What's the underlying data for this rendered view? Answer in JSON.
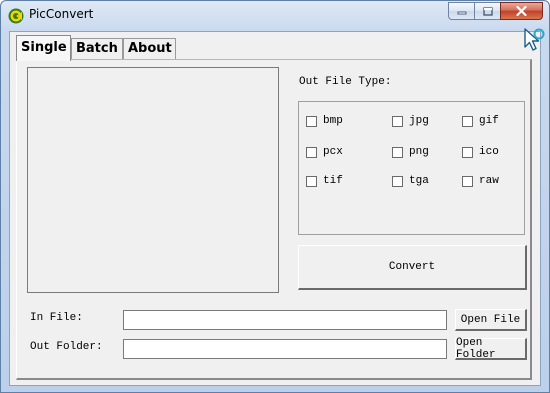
{
  "window": {
    "title": "PicConvert",
    "icon": "app-logo-icon",
    "controls": {
      "minimize": "minimize-icon",
      "maximize": "maximize-icon",
      "close": "close-icon"
    }
  },
  "tabs": [
    {
      "label": "Single",
      "active": true
    },
    {
      "label": "Batch",
      "active": false
    },
    {
      "label": "About",
      "active": false
    }
  ],
  "single": {
    "out_file_type_label": "Out File Type:",
    "formats": [
      {
        "label": "bmp",
        "checked": false
      },
      {
        "label": "jpg",
        "checked": false
      },
      {
        "label": "gif",
        "checked": false
      },
      {
        "label": "pcx",
        "checked": false
      },
      {
        "label": "png",
        "checked": false
      },
      {
        "label": "ico",
        "checked": false
      },
      {
        "label": "tif",
        "checked": false
      },
      {
        "label": "tga",
        "checked": false
      },
      {
        "label": "raw",
        "checked": false
      }
    ],
    "convert_label": "Convert",
    "in_file_label": "In File:",
    "in_file_value": "",
    "open_file_label": "Open File",
    "out_folder_label": "Out Folder:",
    "out_folder_value": "",
    "open_folder_label": "Open Folder"
  },
  "colors": {
    "title_bar": "#c9d9ee",
    "client_bg": "#f0f0f0",
    "close_button": "#c2402a"
  }
}
